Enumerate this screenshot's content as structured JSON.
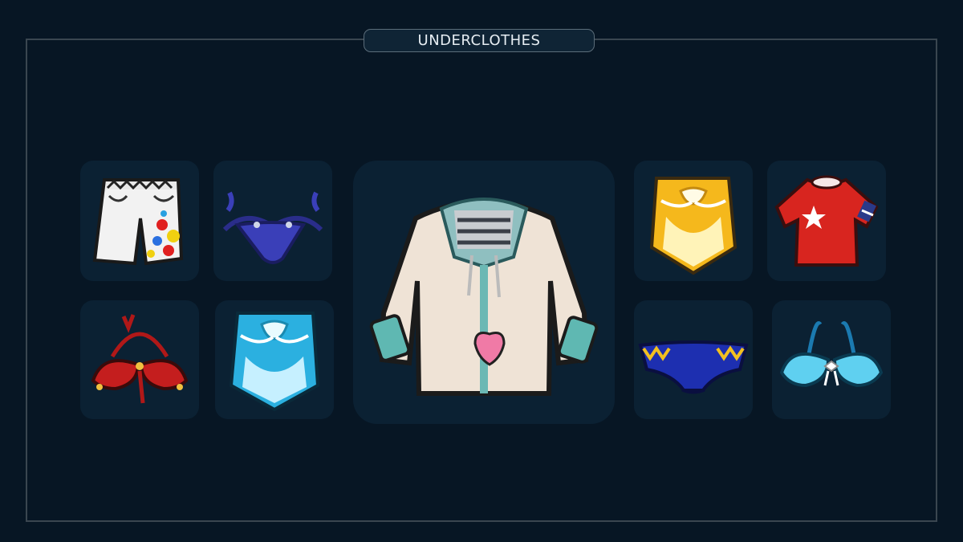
{
  "header": {
    "title": "UNDERCLOTHES"
  },
  "items": [
    {
      "icon": "swim-trunks-icon"
    },
    {
      "icon": "bikini-bottom-navy-icon"
    },
    {
      "icon": "hoodie-jacket-icon"
    },
    {
      "icon": "sarong-yellow-icon"
    },
    {
      "icon": "red-tshirt-icon"
    },
    {
      "icon": "bikini-top-red-icon"
    },
    {
      "icon": "sarong-blue-icon"
    },
    {
      "icon": "swim-brief-blue-icon"
    },
    {
      "icon": "bikini-top-blue-icon"
    }
  ],
  "colors": {
    "background": "#071624",
    "slot": "#0b2133",
    "frame_border": "#3a4650",
    "title_text": "#e6edf2"
  }
}
